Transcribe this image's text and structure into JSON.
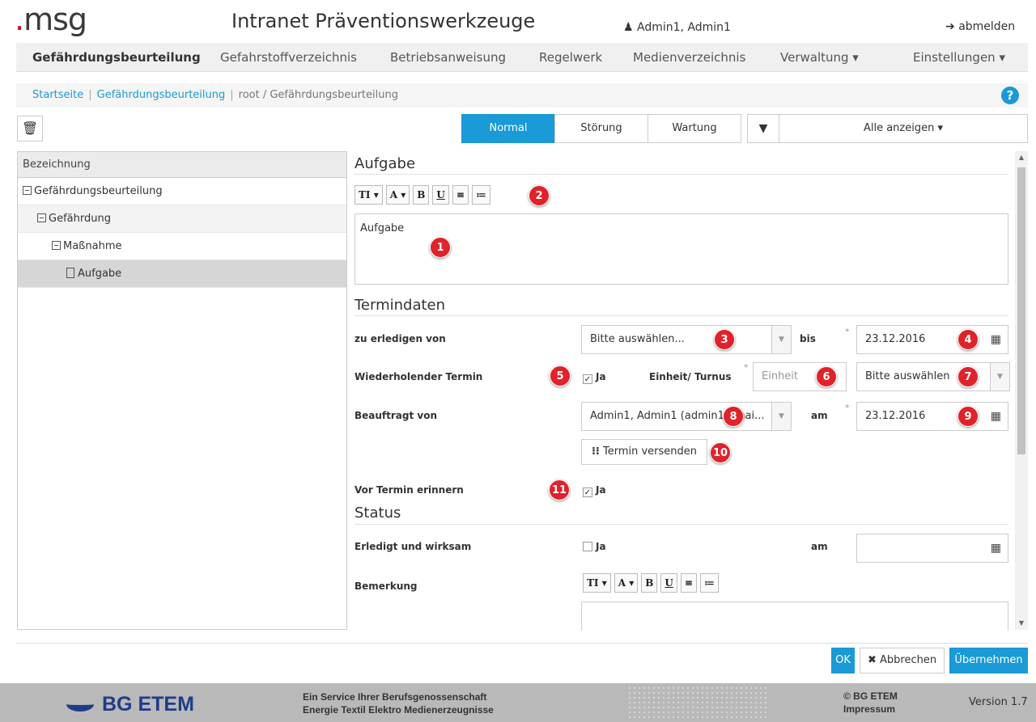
{
  "header": {
    "logo_dot": ".",
    "logo_text": "msg",
    "app_title": "Intranet Präventionswerkzeuge",
    "user": "Admin1, Admin1",
    "logout": "abmelden"
  },
  "nav": {
    "items": [
      {
        "label": "Gefährdungsbeurteilung",
        "active": true
      },
      {
        "label": "Gefahrstoffverzeichnis"
      },
      {
        "label": "Betriebsanweisung"
      },
      {
        "label": "Regelwerk"
      },
      {
        "label": "Medienverzeichnis"
      },
      {
        "label": "Verwaltung ▾"
      },
      {
        "label": "Einstellungen ▾"
      }
    ]
  },
  "breadcrumb": {
    "home": "Startseite",
    "section": "Gefährdungsbeurteilung",
    "current": "root / Gefährdungsbeurteilung",
    "sep": "|"
  },
  "help_icon": "?",
  "toolbar": {
    "modes": [
      "Normal",
      "Störung",
      "Wartung"
    ],
    "active_mode": "Normal",
    "filter_label": "Alle anzeigen ▾"
  },
  "tree": {
    "header": "Bezeichnung",
    "items": [
      {
        "label": "Gefährdungsbeurteilung",
        "icon": "collapse-icon"
      },
      {
        "label": "Gefährdung",
        "icon": "collapse-icon"
      },
      {
        "label": "Maßnahme",
        "icon": "collapse-icon"
      },
      {
        "label": "Aufgabe",
        "icon": "document-icon",
        "selected": true
      }
    ]
  },
  "form": {
    "aufgabe": {
      "title": "Aufgabe",
      "text": "Aufgabe",
      "rte": [
        "TI ▾",
        "A ▾",
        "B",
        "U",
        "≡",
        "≔"
      ]
    },
    "termindaten": {
      "title": "Termindaten",
      "zu_erledigen_label": "zu erledigen von",
      "zu_erledigen_value": "Bitte auswählen...",
      "bis_label": "bis",
      "bis_value": "23.12.2016",
      "wiederholend_label": "Wiederholender Termin",
      "wiederholend_check": "Ja",
      "einheit_label": "Einheit/ Turnus",
      "einheit_placeholder": "Einheit",
      "turnus_value": "Bitte auswählen",
      "beauftragt_label": "Beauftragt von",
      "beauftragt_value": "Admin1, Admin1 (admin1@mai...",
      "am_label": "am",
      "am_value": "23.12.2016",
      "send_button": "Termin versenden",
      "erinnern_label": "Vor Termin erinnern",
      "erinnern_check": "Ja",
      "required_mark": "*"
    },
    "status": {
      "title": "Status",
      "erledigt_label": "Erledigt und wirksam",
      "erledigt_check": "Ja",
      "am_label": "am",
      "am_value": "",
      "bemerkung_label": "Bemerkung",
      "rte": [
        "TI ▾",
        "A ▾",
        "B",
        "U",
        "≡",
        "≔"
      ]
    }
  },
  "badges": [
    "1",
    "2",
    "3",
    "4",
    "5",
    "6",
    "7",
    "8",
    "9",
    "10",
    "11"
  ],
  "footer_buttons": {
    "ok": "OK",
    "cancel": "Abbrechen",
    "apply": "Übernehmen"
  },
  "footer": {
    "bg_logo": "BG ETEM",
    "service_line1": "Ein Service Ihrer Berufsgenossenschaft",
    "service_line2": "Energie Textil Elektro Medienerzeugnisse",
    "copyright": "© BG ETEM",
    "impressum": "Impressum",
    "version": "Version 1.7"
  },
  "colors": {
    "accent": "#1a9ad6",
    "badge": "#e0222a",
    "logo_red": "#c8102e",
    "bg_blue": "#1f3c88"
  }
}
